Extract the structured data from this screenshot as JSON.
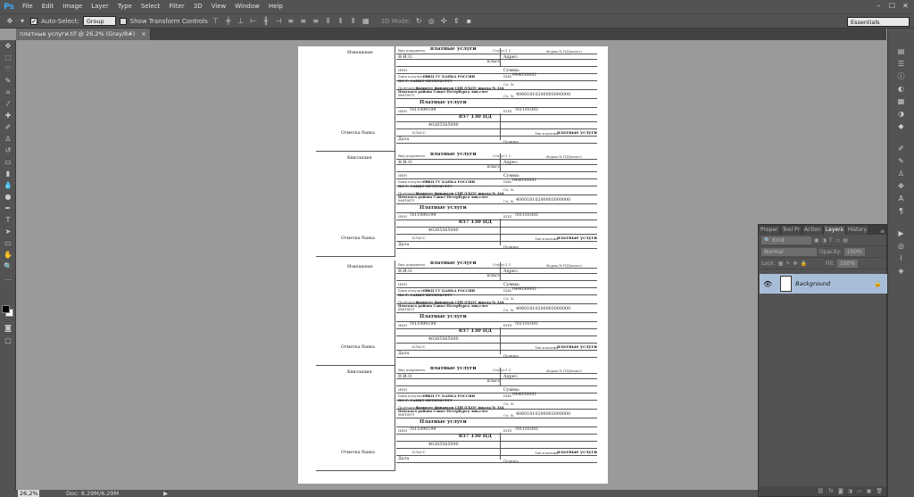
{
  "app": {
    "logo": "Ps"
  },
  "menu": [
    "File",
    "Edit",
    "Image",
    "Layer",
    "Type",
    "Select",
    "Filter",
    "3D",
    "View",
    "Window",
    "Help"
  ],
  "window_controls": [
    "–",
    "☐",
    "✕"
  ],
  "options": {
    "auto_select_label": "Auto-Select:",
    "auto_select_value": "Group",
    "show_transform_label": "Show Transform Controls",
    "mode_3d_label": "3D Mode:",
    "workspace": "Essentials"
  },
  "document_tab": {
    "title": "платные услуги.tif @ 26,2% (Gray/8#)",
    "close": "×"
  },
  "status": {
    "zoom": "26,2%",
    "doc_info": "Doc: 8,29M/8,29M"
  },
  "panel": {
    "tabs": [
      "Proper",
      "Tool Pr",
      "Action",
      "Layers",
      "History"
    ],
    "active_tab": "Layers",
    "kind_label": "Kind",
    "blend_mode": "Normal",
    "opacity_label": "Opacity:",
    "opacity_value": "100%",
    "lock_label": "Lock:",
    "fill_label": "Fill:",
    "fill_value": "100%",
    "layer_name": "Background"
  },
  "form": {
    "izveshchenie": "Извещение",
    "kvitantsiya": "Квитанция",
    "otmetka_banka": "Отметка банка",
    "vid_doc_label": "Вид документа",
    "title": "платные услуги",
    "status_label": "Статус",
    "status_value": "1 3",
    "form_no": "Форма № ПД(налог)",
    "fio": "Ф.И.О.",
    "klass": "класс",
    "adres": "Адрес:",
    "inn_payer": "ИНН",
    "summa": "Сумма:",
    "bank_recipient_label": "Банк получателя",
    "bank_recipient": "ГРКЦ ГУ БАНКА РОССИИ",
    "bank_city": "ПО  Г. САНКТ-ПЕТЕРБУРГУ",
    "bik_label": "БИК",
    "bik": "044030001",
    "ks_label": "Сч. №",
    "recipient_label": "Получатель",
    "recipient": "Комитет финансов СПб (ГБОУ школа № 344",
    "recipient2": "Невского района Санкт-Петербурга лиц.счет",
    "recipient3": "0601007)",
    "rs_label": "Сч. №",
    "rs": "40601810200003000000",
    "purpose": "Платные услуги",
    "inn_label": "ИНН",
    "inn": "7811090199",
    "kpp_label": "КПП",
    "kpp": "781101001",
    "kbk": "857  130  ПД",
    "okato": "40265565000",
    "klass2": "КЛАСС",
    "data": "Дата",
    "podpis": "Подпись",
    "plat_label": "Тип платежа",
    "plat": "платные услуги"
  }
}
